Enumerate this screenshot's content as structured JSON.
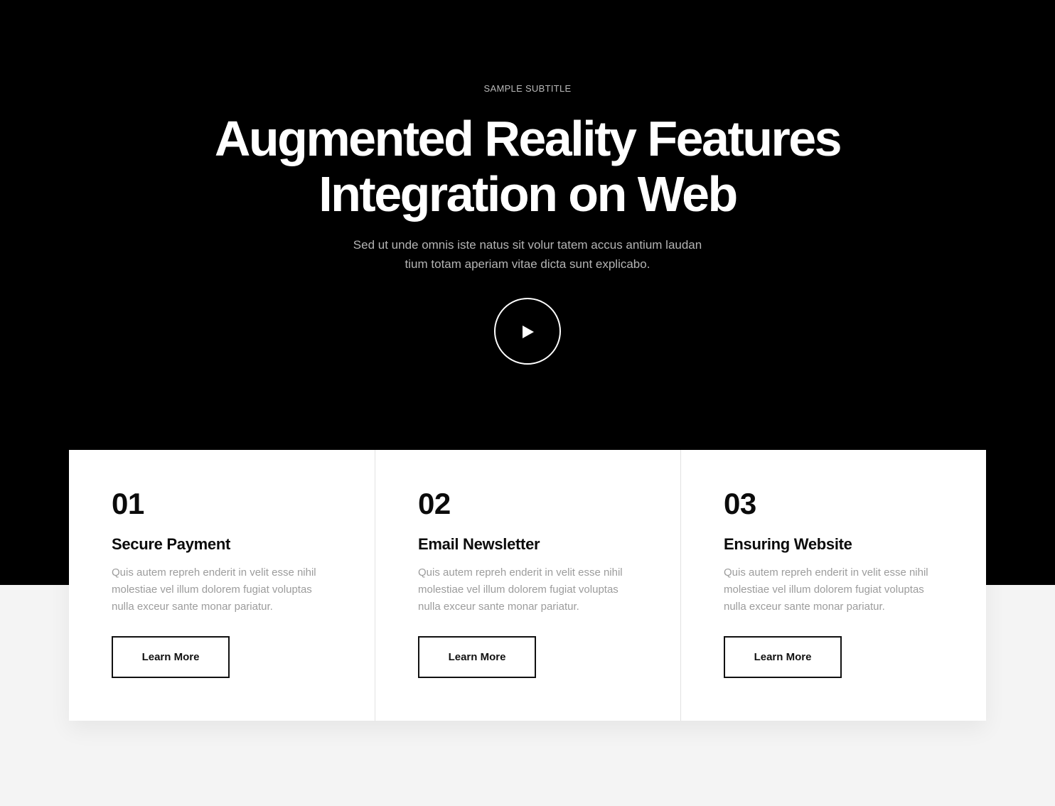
{
  "hero": {
    "subtitle": "SAMPLE SUBTITLE",
    "title_lines": [
      "Augmented Reality Features",
      "Integration on Web"
    ],
    "description_lines": [
      "Sed ut unde omnis iste natus sit volur tatem accus antium laudan",
      "tium totam aperiam vitae dicta sunt explicabo."
    ],
    "play_icon": "play-icon"
  },
  "features": [
    {
      "number": "01",
      "title": "Secure Payment",
      "text_lines": [
        "Quis autem repreh enderit in velit esse nihil",
        "molestiae vel illum dolorem fugiat voluptas",
        "nulla exceur sante monar pariatur."
      ],
      "button": "Learn More"
    },
    {
      "number": "02",
      "title": "Email Newsletter",
      "text_lines": [
        "Quis autem repreh enderit in velit esse nihil",
        "molestiae vel illum dolorem fugiat voluptas",
        "nulla exceur sante monar pariatur."
      ],
      "button": "Learn More"
    },
    {
      "number": "03",
      "title": "Ensuring Website",
      "text_lines": [
        "Quis autem repreh enderit in velit esse nihil",
        "molestiae vel illum dolorem fugiat voluptas",
        "nulla exceur sante monar pariatur."
      ],
      "button": "Learn More"
    }
  ],
  "colors": {
    "hero_background": "#000000",
    "page_background": "#f4f4f4",
    "card_background": "#ffffff",
    "muted_text": "#9c9c9c"
  }
}
